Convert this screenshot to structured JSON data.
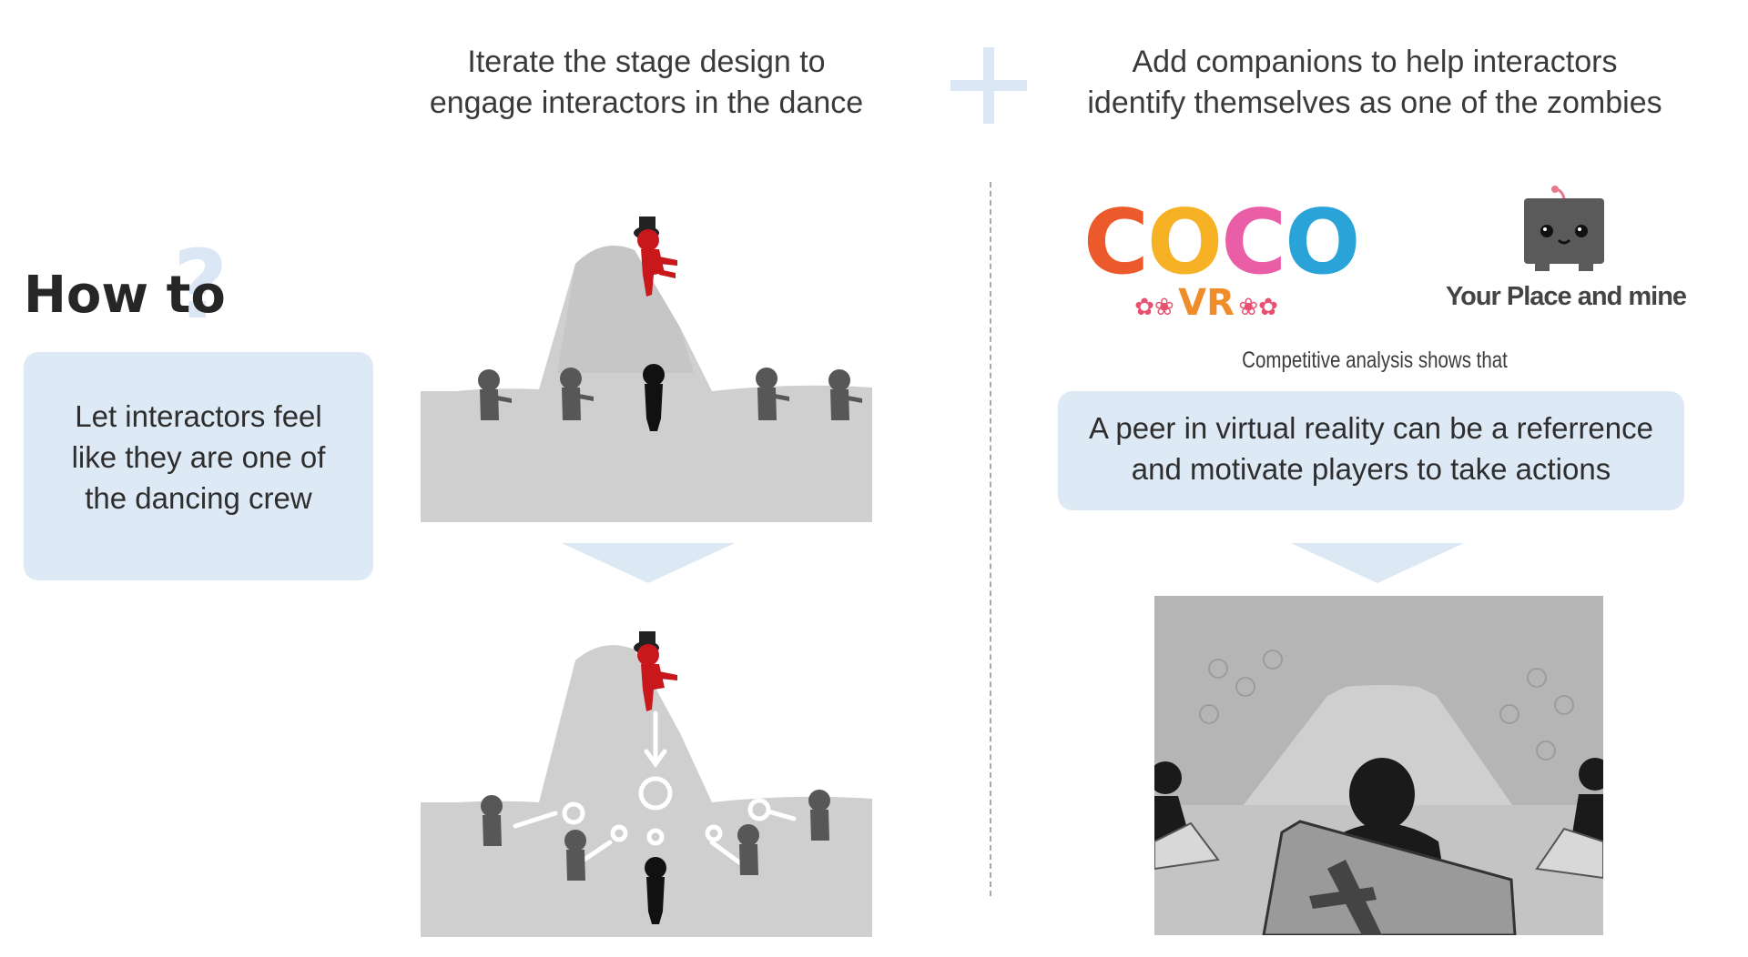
{
  "left_panel": {
    "heading": "How to",
    "heading_mark": "?",
    "goal_box": [
      "Let interactors feel",
      "like they are one of",
      "the dancing crew"
    ]
  },
  "middle_column": {
    "header": [
      "Iterate the stage design to",
      "engage interactors in the dance"
    ]
  },
  "right_column": {
    "header": [
      "Add companions to help interactors",
      "identify themselves as one of the zombies"
    ],
    "logos": {
      "coco_letters": [
        "C",
        "O",
        "C",
        "O"
      ],
      "coco_colors": [
        "#ec5a2c",
        "#f6b224",
        "#ea5ea8",
        "#2aa3d8"
      ],
      "coco_sub": "VR",
      "ypm_label": "Your Place and mine"
    },
    "analysis_caption": "Competitive analysis shows that",
    "insight_box": [
      "A peer in virtual reality can be a referrence",
      "and motivate players to take actions"
    ]
  },
  "colors": {
    "accent_box": "#dde9f5",
    "plus_sign": "#dbe7f4",
    "zombie_red": "#c8181c",
    "hill_gray": "#cfcfcf"
  },
  "icons": [
    "plus-icon",
    "down-arrow-icon",
    "robot-icon",
    "coco-logo-icon"
  ]
}
